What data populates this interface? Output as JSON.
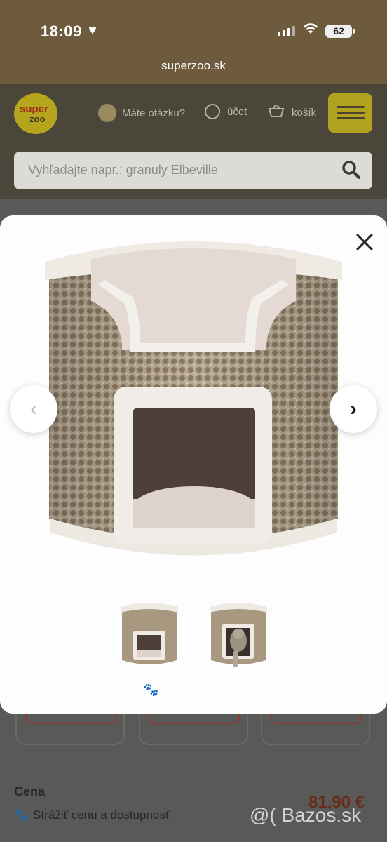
{
  "status_bar": {
    "time": "18:09",
    "battery": "62"
  },
  "browser": {
    "url": "superzoo.sk"
  },
  "site": {
    "logo_top": "super",
    "logo_bottom": "zoo",
    "question_label": "Máte otázku?",
    "account_label": "účet",
    "cart_label": "košík",
    "search_placeholder": "Vyhľadajte napr.: granuly Elbeville"
  },
  "product": {
    "price_label": "Cena",
    "price": "81,90 €",
    "watch_link": "Strážiť cenu a dostupnosť"
  },
  "gallery": {
    "images": [
      "cat-tower-front",
      "cat-tower-with-cat"
    ],
    "selected_index": 0
  },
  "watermark": "@( Bazos.sk",
  "colors": {
    "brand_yellow": "#b2a31e",
    "price_red": "#6a2a1a"
  }
}
